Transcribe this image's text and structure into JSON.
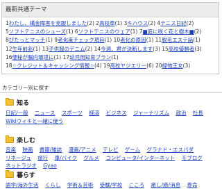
{
  "theme_box": {
    "title": "最新共通テーマ",
    "items": [
      {
        "num": "1",
        "label": "わたし、構金障害を克服しました",
        "count": "(2)"
      },
      {
        "num": "2",
        "label": "高校車",
        "count": "(1)"
      },
      {
        "num": "3",
        "label": "キハウス",
        "count": "(2)"
      },
      {
        "num": "4",
        "label": "テニス日記",
        "count": "(2)"
      },
      {
        "num": "5",
        "label": "ソフトテニスのシューズ",
        "count": "(1)"
      },
      {
        "num": "6",
        "label": "ソフトテニスのウェア",
        "count": "(1)"
      },
      {
        "num": "7",
        "label": "■庭に咲く花と樹木■",
        "count": "(2)"
      },
      {
        "num": "8",
        "label": "ぴたっとマッチ",
        "count": "(1)"
      },
      {
        "num": "9",
        "label": "老化度チェック項目",
        "count": "(1)"
      },
      {
        "num": "10",
        "label": "老化の原因",
        "count": "(1)"
      },
      {
        "num": "11",
        "label": "脱毛エステ話",
        "count": "(1)"
      },
      {
        "num": "12",
        "label": "生年前兆",
        "count": "(1)"
      },
      {
        "num": "13",
        "label": "子供服のデニム",
        "count": "(2)"
      },
      {
        "num": "14",
        "label": "今週、君が決断します",
        "count": "(3)"
      },
      {
        "num": "15",
        "label": "高校優勝者",
        "count": "(3)"
      },
      {
        "num": "16",
        "label": "便秘が腸内環境に",
        "count": "(1)"
      },
      {
        "num": "17",
        "label": "幼児用知育ブラン",
        "count": "(1)"
      },
      {
        "num": "18",
        "label": "☆クレジット＆キャッシング情報☆",
        "count": "(4)"
      },
      {
        "num": "19",
        "label": "高校ヤジエリー",
        "count": "(6)"
      },
      {
        "num": "20",
        "label": "緑物王女",
        "count": "(3)"
      }
    ]
  },
  "category_heading": "カテゴリー別に探す",
  "sections": {
    "know": {
      "title": "知る",
      "links": [
        "日記/一般",
        "ニュース",
        "スポーツ",
        "経済",
        "ビジネス",
        "ジャーナリズム",
        "政治",
        "社長",
        "Wikiウィキと一緒に使う"
      ]
    },
    "enjoy": {
      "title": "楽しむ",
      "links": [
        "音楽",
        "映画",
        "書籍/雑誌",
        "漫画/アニメ",
        "テレビ",
        "ゲーム",
        "グラナド・エスパダ",
        "リネージュ",
        "旅行",
        "車/バイク",
        "グルメ",
        "コンピュータ/インターネット",
        "モブログ",
        "ネットラジオ",
        "Gyao"
      ]
    },
    "live": {
      "title": "暮らす",
      "links": [
        "語学/海外生活",
        "くらし",
        "学術＆芸術",
        "受験/学校",
        "こころ",
        "癒し/癒/消息",
        "寿命"
      ]
    }
  }
}
